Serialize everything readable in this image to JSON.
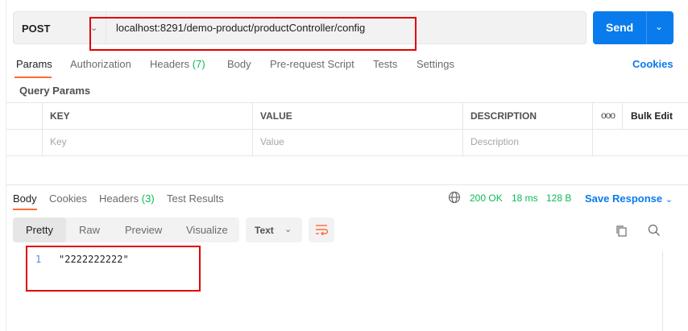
{
  "request": {
    "method": "POST",
    "url": "localhost:8291/demo-product/productController/config",
    "send_label": "Send"
  },
  "request_tabs": {
    "params": "Params",
    "authorization": "Authorization",
    "headers": "Headers",
    "headers_count": "(7)",
    "body": "Body",
    "pre_request": "Pre-request Script",
    "tests": "Tests",
    "settings": "Settings",
    "cookies": "Cookies"
  },
  "query_params": {
    "title": "Query Params",
    "columns": [
      "KEY",
      "VALUE",
      "DESCRIPTION"
    ],
    "placeholders": [
      "Key",
      "Value",
      "Description"
    ],
    "bulk_edit": "Bulk Edit",
    "more": "ooo"
  },
  "response_tabs": {
    "body": "Body",
    "cookies": "Cookies",
    "headers": "Headers",
    "headers_count": "(3)",
    "test_results": "Test Results"
  },
  "response_meta": {
    "status": "200 OK",
    "time": "18 ms",
    "size": "128 B",
    "save": "Save Response"
  },
  "view": {
    "tabs": [
      "Pretty",
      "Raw",
      "Preview",
      "Visualize"
    ],
    "format": "Text"
  },
  "response_body": {
    "line_number": "1",
    "content": "\"2222222222\""
  },
  "colors": {
    "accent": "#ff6c37",
    "primary": "#097bed",
    "success": "#0cbb52",
    "highlight": "#e00000"
  }
}
